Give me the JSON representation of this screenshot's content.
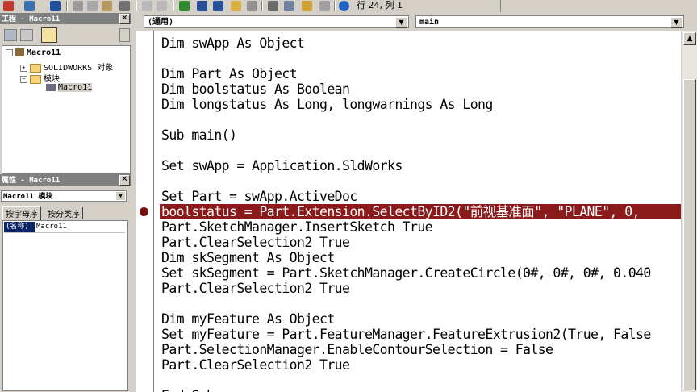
{
  "toolbar": {
    "position": "行 24, 列 1",
    "icons": [
      "vb-icon",
      "insert-icon",
      "save-icon",
      "cut-icon",
      "copy-icon",
      "paste-icon",
      "find-icon",
      "undo-icon",
      "redo-icon",
      "run-icon",
      "pause-icon",
      "stop-icon",
      "design-mode-icon",
      "project-explorer-icon",
      "properties-icon",
      "object-browser-icon",
      "toolbox-icon",
      "help-icon"
    ]
  },
  "project": {
    "title": "工程 - Macro11",
    "root": "Macro11",
    "folders": [
      "SOLIDWORKS 对象",
      "模块"
    ],
    "module": "Macro11"
  },
  "properties": {
    "title": "属性 - Macro11",
    "object": "Macro11 模块",
    "tabs": [
      "按字母序",
      "按分类序"
    ],
    "prop_name": "(名称)",
    "prop_value": "Macro11"
  },
  "editor": {
    "object_combo": "(通用)",
    "proc_combo": "main",
    "lines": [
      "Dim swApp As Object",
      "",
      "Dim Part As Object",
      "Dim boolstatus As Boolean",
      "Dim longstatus As Long, longwarnings As Long",
      "",
      "Sub main()",
      "",
      "Set swApp = Application.SldWorks",
      "",
      "Set Part = swApp.ActiveDoc",
      "boolstatus = Part.Extension.SelectByID2(\"前视基准面\", \"PLANE\", 0,",
      "Part.SketchManager.InsertSketch True",
      "Part.ClearSelection2 True",
      "Dim skSegment As Object",
      "Set skSegment = Part.SketchManager.CreateCircle(0#, 0#, 0#, 0.040",
      "Part.ClearSelection2 True",
      "",
      "Dim myFeature As Object",
      "Set myFeature = Part.FeatureManager.FeatureExtrusion2(True, False",
      "Part.SelectionManager.EnableContourSelection = False",
      "Part.ClearSelection2 True",
      "",
      "End Sub"
    ],
    "highlight_line": 11,
    "breakpoint_line": 11
  },
  "colors": {
    "highlight": "#8b1a1a",
    "panel_title": "#808080"
  }
}
